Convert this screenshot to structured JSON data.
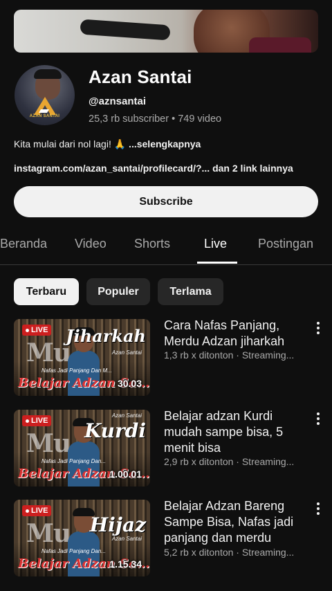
{
  "channel": {
    "name": "Azan Santai",
    "handle": "@aznsantai",
    "stats": "25,3 rb subscriber • 749 video",
    "description": "Kita mulai dari nol lagi! 🙏",
    "description_more": " ...selengkapnya",
    "link": "instagram.com/azan_santai/profilecard/?...",
    "link_more": " dan 2 link lainnya",
    "avatar_logo_text": "AZAN SANTAI",
    "subscribe_label": "Subscribe"
  },
  "tabs": [
    {
      "label": "Beranda"
    },
    {
      "label": "Video"
    },
    {
      "label": "Shorts"
    },
    {
      "label": "Live"
    },
    {
      "label": "Postingan"
    }
  ],
  "active_tab": "Live",
  "filters": [
    {
      "label": "Terbaru"
    },
    {
      "label": "Populer"
    },
    {
      "label": "Terlama"
    }
  ],
  "active_filter": "Terbaru",
  "videos": [
    {
      "title": "Cara Nafas Panjang, Merdu  Adzan jiharkah",
      "meta": "1,3 rb x ditonton · Streaming...",
      "duration": "30.03",
      "badge": "LIVE",
      "thumb_big": "Mu",
      "thumb_script": "Jiharkah",
      "thumb_script_small": "Azan Santai",
      "thumb_sub": "Nafas Jadi Panjang Dan M...",
      "thumb_belajar": "Belajar Adzan Sa..."
    },
    {
      "title": "Belajar adzan Kurdi mudah sampe bisa, 5 menit bisa",
      "meta": "2,9 rb x ditonton · Streaming...",
      "duration": "1.00.01",
      "badge": "LIVE",
      "thumb_big": "Mu",
      "thumb_script": "Kurdi",
      "thumb_script_small": "Azan Santai",
      "thumb_sub": "Nafas Jadi Panjang Dan...",
      "thumb_belajar": "Belajar Adzan Sa..."
    },
    {
      "title": "Belajar Adzan Bareng Sampe Bisa, Nafas jadi panjang dan merdu",
      "meta": "5,2 rb x ditonton · Streaming...",
      "duration": "1.15.34",
      "badge": "LIVE",
      "thumb_big": "Mu",
      "thumb_script": "Hijaz",
      "thumb_script_small": "Azan Santai",
      "thumb_sub": "Nafas Jadi Panjang Dan...",
      "thumb_belajar": "Belajar Adzan Sa..."
    }
  ]
}
